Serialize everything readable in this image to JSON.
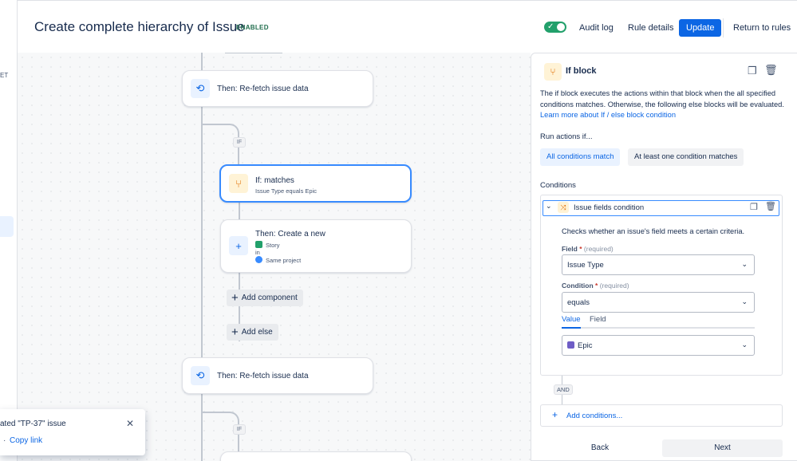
{
  "header": {
    "title": "Create complete hierarchy of Issue",
    "status": "ENABLED",
    "toggle_check": "✓",
    "audit_log": "Audit log",
    "rule_details": "Rule details",
    "update": "Update",
    "return_to_rules": "Return to rules"
  },
  "left_edge": {
    "truncated_text": "ET"
  },
  "canvas": {
    "cards": {
      "refetch_top": {
        "title": "Then: Re-fetch issue data",
        "icon": "refresh-icon"
      },
      "if_matches": {
        "title": "If: matches",
        "subtitle": "Issue Type equals Epic",
        "icon": "branch-icon"
      },
      "create_new": {
        "title": "Then: Create a new",
        "issue_type": "Story",
        "in": "in",
        "project": "Same project",
        "icon": "plus-icon"
      },
      "refetch_bottom": {
        "title": "Then: Re-fetch issue data",
        "icon": "refresh-icon"
      }
    },
    "if_chip": "IF",
    "add_component": "Add component",
    "add_else": "Add else"
  },
  "toast": {
    "title": "ated \"TP-37\" issue",
    "separator": "·",
    "link": "Copy link"
  },
  "panel": {
    "title": "If block",
    "description": "The if block executes the actions within that block when the all specified conditions matches. Otherwise, the following else blocks will be evaluated.",
    "learn_more": "Learn more about If / else block condition",
    "run_actions_label": "Run actions if...",
    "options": [
      "All conditions match",
      "At least one condition matches"
    ],
    "selected_option": "All conditions match",
    "conditions_label": "Conditions",
    "condition": {
      "title": "Issue fields condition",
      "description": "Checks whether an issue's field meets a certain criteria.",
      "field_label": "Field",
      "field_required": "(required)",
      "field_value": "Issue Type",
      "condition_label": "Condition",
      "condition_required": "(required)",
      "condition_value": "equals",
      "tabs": [
        "Value",
        "Field"
      ],
      "active_tab": "Value",
      "value": "Epic"
    },
    "and_label": "AND",
    "add_conditions": "Add conditions...",
    "back": "Back",
    "next": "Next"
  },
  "colors": {
    "primary": "#0c66e4",
    "enabled_green": "#216e4e",
    "toggle_green": "#22a06b",
    "selected_border": "#388bff",
    "branch_orange": "#e06c00"
  }
}
